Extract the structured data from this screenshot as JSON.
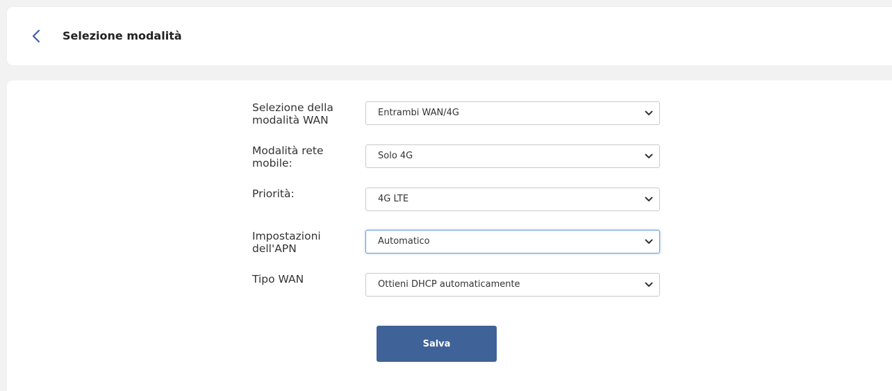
{
  "header": {
    "title": "Selezione modalità",
    "back_icon": "chevron-left-icon"
  },
  "form": {
    "rows": [
      {
        "label": "Selezione della modalità WAN",
        "value": "Entrambi WAN/4G"
      },
      {
        "label": "Modalità rete mobile:",
        "value": "Solo 4G"
      },
      {
        "label": "Priorità:",
        "value": "4G LTE"
      },
      {
        "label": "Impostazioni dell'APN",
        "value": "Automatico"
      },
      {
        "label": "Tipo WAN",
        "value": "Ottieni DHCP automaticamente"
      }
    ]
  },
  "actions": {
    "save_label": "Salva"
  },
  "colors": {
    "accent": "#3f6298",
    "back_icon": "#3a5fa8",
    "focus_border": "#6f9fd6"
  }
}
